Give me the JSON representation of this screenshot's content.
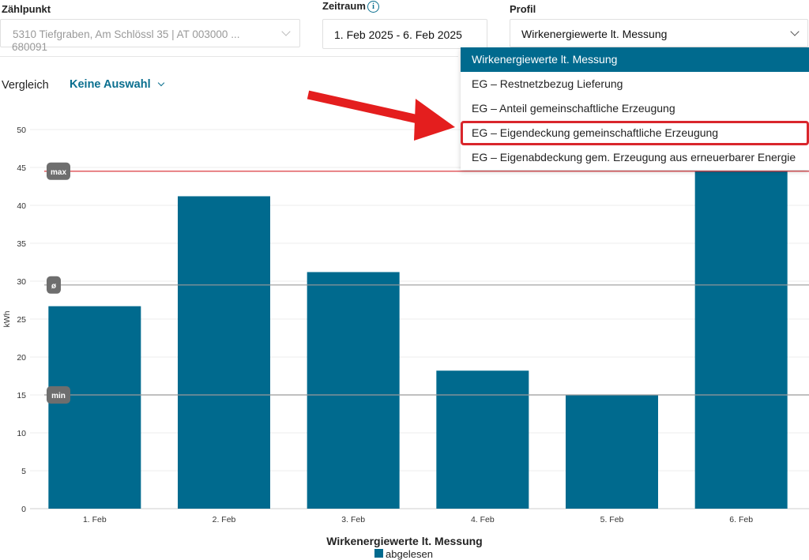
{
  "meter": {
    "label": "Zählpunkt",
    "value": "5310 Tiefgraben, Am Schlössl 35 | AT 003000 ...",
    "value2": "680091"
  },
  "period": {
    "label": "Zeitraum",
    "value": "1. Feb 2025 - 6. Feb 2025"
  },
  "profile": {
    "label": "Profil",
    "value": "Wirkenergiewerte lt. Messung",
    "options": [
      "Wirkenergiewerte lt. Messung",
      "EG – Restnetzbezug Lieferung",
      "EG – Anteil gemeinschaftliche Erzeugung",
      "EG – Eigendeckung gemeinschaftliche Erzeugung",
      "EG – Eigenabdeckung gem. Erzeugung aus erneuerbarer Energie"
    ]
  },
  "compare": {
    "label": "Vergleich",
    "value": "Keine Auswahl"
  },
  "colors": {
    "accent": "#006a8e",
    "max_line": "#d9262c",
    "highlight": "#d9262c",
    "arrow": "#e41e1e"
  },
  "chart_data": {
    "type": "bar",
    "title": "Wirkenergiewerte lt. Messung",
    "ylabel": "kWh",
    "ylim": [
      0,
      50
    ],
    "yticks": [
      0,
      5,
      10,
      15,
      20,
      25,
      30,
      35,
      40,
      45,
      50
    ],
    "grid": true,
    "categories": [
      "1. Feb",
      "2. Feb",
      "3. Feb",
      "4. Feb",
      "5. Feb",
      "6. Feb"
    ],
    "series": [
      {
        "name": "abgelesen",
        "values": [
          26.7,
          41.2,
          31.2,
          18.2,
          15.0,
          44.5
        ]
      }
    ],
    "reference_lines": [
      {
        "label": "max",
        "value": 44.5
      },
      {
        "label": "ø",
        "value": 29.5
      },
      {
        "label": "min",
        "value": 15.0
      }
    ],
    "legend": "bottom"
  }
}
